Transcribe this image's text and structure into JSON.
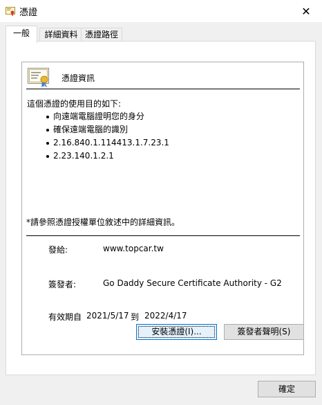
{
  "window": {
    "title": "憑證",
    "close_symbol": "✕"
  },
  "tabs": [
    "一般",
    "詳細資料",
    "憑證路徑"
  ],
  "general": {
    "header": "憑證資訊",
    "purpose_heading": "這個憑證的使用目的如下:",
    "purposes": [
      "向遠端電腦證明您的身分",
      "確保遠端電腦的識別",
      "2.16.840.1.114413.1.7.23.1",
      "2.23.140.1.2.1"
    ],
    "note": "*請參照憑證授權單位敘述中的詳細資訊。",
    "issued_to_label": "發給:",
    "issued_to_value": "www.topcar.tw",
    "issued_by_label": "簽發者:",
    "issued_by_value": "Go Daddy Secure Certificate Authority - G2",
    "valid_label": "有效期自",
    "valid_from": "2021/5/17",
    "valid_to_word": "到",
    "valid_to": "2022/4/17",
    "install_button": "安裝憑證(I)...",
    "issuer_statement_button": "簽發者聲明(S)"
  },
  "ok_button": "確定"
}
